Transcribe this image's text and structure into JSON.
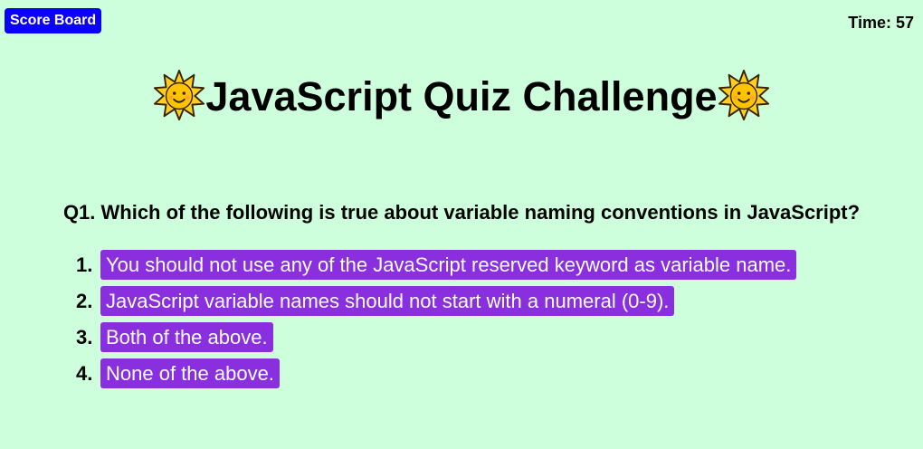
{
  "header": {
    "score_board_label": "Score Board",
    "timer_text": "Time: 57"
  },
  "title": {
    "text": "JavaScript Quiz Challenge",
    "icon": "sun-face-icon"
  },
  "question": {
    "text": "Q1. Which of the following is true about variable naming conventions in JavaScript?"
  },
  "options": [
    {
      "number": "1.",
      "label": "You should not use any of the JavaScript reserved keyword as variable name."
    },
    {
      "number": "2.",
      "label": "JavaScript variable names should not start with a numeral (0-9)."
    },
    {
      "number": "3.",
      "label": "Both of the above."
    },
    {
      "number": "4.",
      "label": "None of the above."
    }
  ],
  "colors": {
    "background": "#ceffdc",
    "score_button": "#0a00ff",
    "option_button": "#8a2fe0"
  }
}
